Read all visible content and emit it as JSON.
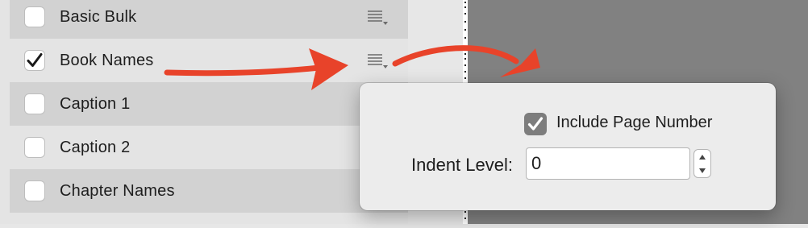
{
  "style_list": {
    "items": [
      {
        "label": "Basic Bulk",
        "checked": false,
        "shade": "dark"
      },
      {
        "label": "Book Names",
        "checked": true,
        "shade": "light"
      },
      {
        "label": "Caption 1",
        "checked": false,
        "shade": "dark"
      },
      {
        "label": "Caption 2",
        "checked": false,
        "shade": "light"
      },
      {
        "label": "Chapter Names",
        "checked": false,
        "shade": "dark"
      }
    ],
    "options_icon": "list-options-icon"
  },
  "popover": {
    "include_page_number_label": "Include Page Number",
    "include_page_number_checked": true,
    "indent_level_label": "Indent Level:",
    "indent_level_value": "0"
  },
  "colors": {
    "annotation_arrow": "#e8432a",
    "canvas": "#818181",
    "row_dark": "#d2d2d2",
    "row_light": "#e4e4e4",
    "checkbox_checked_popover": "#7d7d7d"
  }
}
